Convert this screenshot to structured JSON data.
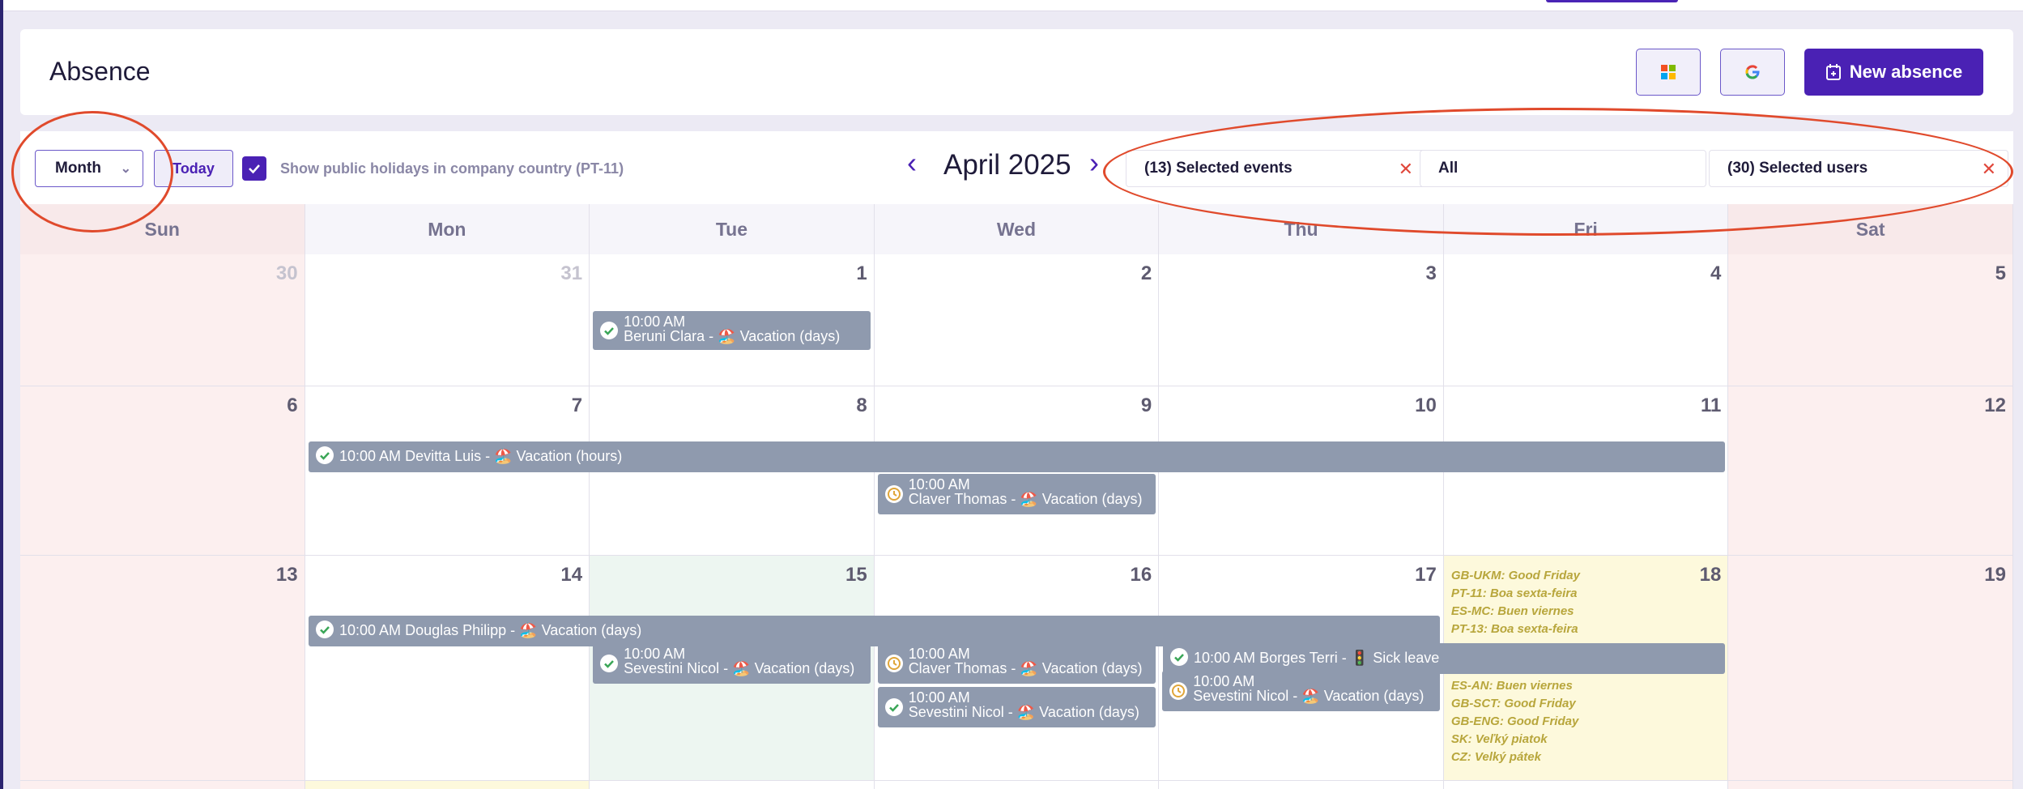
{
  "header": {
    "title": "Absence",
    "new_absence_label": "New absence"
  },
  "toolbar": {
    "view_select": "Month",
    "today_label": "Today",
    "holiday_checkbox_checked": true,
    "holiday_label": "Show public holidays in company country (PT-11)",
    "month_label": "April 2025",
    "filter_events": "(13) Selected events",
    "filter_type": "All",
    "filter_users": "(30) Selected users"
  },
  "calendar": {
    "weekdays": [
      "Sun",
      "Mon",
      "Tue",
      "Wed",
      "Thu",
      "Fri",
      "Sat"
    ],
    "weeks": [
      [
        "30",
        "31",
        "1",
        "2",
        "3",
        "4",
        "5"
      ],
      [
        "6",
        "7",
        "8",
        "9",
        "10",
        "11",
        "12"
      ],
      [
        "13",
        "14",
        "15",
        "16",
        "17",
        "18",
        "19"
      ]
    ],
    "events": {
      "e1": {
        "time": "10:00 AM",
        "text": "Beruni Clara - 🏖️ Vacation (days)",
        "status": "approved"
      },
      "e2": {
        "time": "10:00 AM",
        "text": "Devitta Luis - 🏖️ Vacation (hours)",
        "status": "approved"
      },
      "e3": {
        "time": "10:00 AM",
        "text": "Claver Thomas - 🏖️ Vacation (days)",
        "status": "pending"
      },
      "e4": {
        "time": "10:00 AM",
        "text": "Douglas Philipp - 🏖️ Vacation (days)",
        "status": "approved"
      },
      "e5": {
        "time": "10:00 AM",
        "text": "Sevestini Nicol - 🏖️ Vacation (days)",
        "status": "approved"
      },
      "e6": {
        "time": "10:00 AM",
        "text": "Claver Thomas - 🏖️ Vacation (days)",
        "status": "pending"
      },
      "e7": {
        "time": "10:00 AM",
        "text": "Sevestini Nicol - 🏖️ Vacation (days)",
        "status": "approved"
      },
      "e8": {
        "time": "10:00 AM",
        "text": "Borges Terri - 🚦 Sick leave",
        "status": "approved"
      },
      "e9": {
        "time": "10:00 AM",
        "text": "Sevestini Nicol - 🏖️ Vacation (days)",
        "status": "pending"
      }
    },
    "holidays_top": [
      "GB-UKM: Good Friday",
      "PT-11: Boa sexta-feira",
      "ES-MC: Buen viernes",
      "PT-13: Boa sexta-feira"
    ],
    "holidays_bottom": [
      "ES-AN: Buen viernes",
      "GB-SCT: Good Friday",
      "GB-ENG: Good Friday",
      "SK: Veľký piatok",
      "CZ: Velký pátek"
    ]
  },
  "colors": {
    "accent": "#4a21b4",
    "event_bg": "#8f9aae",
    "weekend_bg": "#fcefef",
    "today_bg": "#edf6f1",
    "holiday_bg": "#fdf9dc",
    "holiday_text": "#b8a63c",
    "annotation": "#e04a2c"
  }
}
